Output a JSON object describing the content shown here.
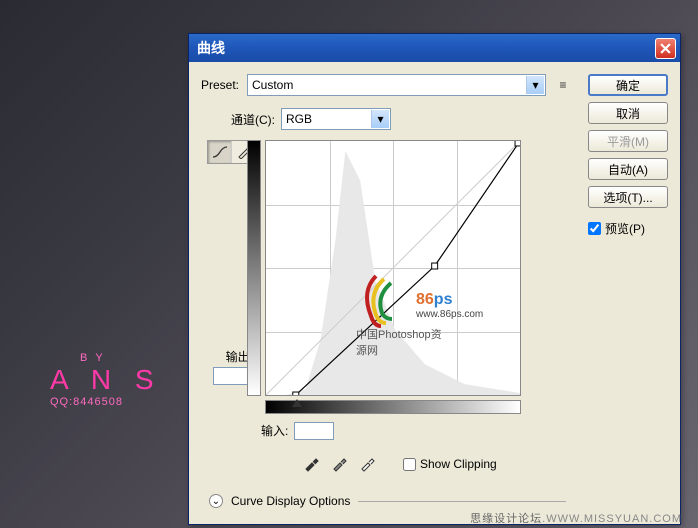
{
  "dialog": {
    "title": "曲线",
    "preset_label": "Preset:",
    "preset_value": "Custom",
    "channel_label": "通道(C):",
    "channel_value": "RGB",
    "output_label": "输出:",
    "input_label": "输入:",
    "show_clipping": "Show Clipping",
    "show_clipping_checked": false,
    "curve_display_options": "Curve Display Options"
  },
  "buttons": {
    "ok": "确定",
    "cancel": "取消",
    "smooth": "平滑(M)",
    "auto": "自动(A)",
    "options": "选项(T)...",
    "preview": "预览(P)",
    "preview_checked": true
  },
  "watermark": {
    "num": "86",
    "ps": "ps",
    "url": "www.86ps.com",
    "cn": "中国Photoshop资源网"
  },
  "bg": {
    "by": "BY",
    "name": "A N S",
    "qq": "QQ:8446508"
  },
  "footer": {
    "cn": "思缘设计论坛",
    "en": ".WWW.MISSYUAN.COM"
  },
  "chart_data": {
    "type": "line",
    "title": "Curves",
    "xlabel": "输入",
    "ylabel": "输出",
    "xlim": [
      0,
      255
    ],
    "ylim": [
      0,
      255
    ],
    "grid": true,
    "channel": "RGB",
    "series": [
      {
        "name": "curve",
        "points": [
          {
            "x": 30,
            "y": 0
          },
          {
            "x": 170,
            "y": 130
          },
          {
            "x": 255,
            "y": 255
          }
        ]
      }
    ],
    "histogram_hint": "light-biased histogram with peak near 70-100 input"
  }
}
